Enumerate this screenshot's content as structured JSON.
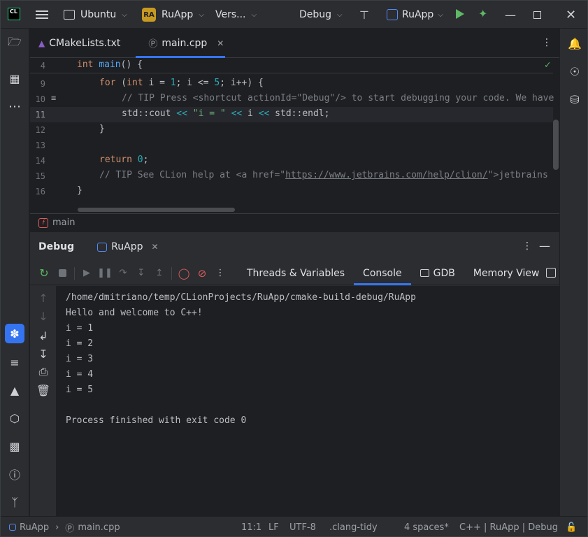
{
  "titlebar": {
    "logo": "CL",
    "workspace": "Ubuntu",
    "project_badge": "RA",
    "project": "RuApp",
    "vcs": "Vers...",
    "config": "Debug",
    "run_config": "RuApp"
  },
  "editor": {
    "tabs": [
      {
        "label": "CMakeLists.txt"
      },
      {
        "label": "main.cpp"
      }
    ],
    "lines": [
      {
        "num": "4"
      },
      {
        "num": "9"
      },
      {
        "num": "10"
      },
      {
        "num": "11"
      },
      {
        "num": "12"
      },
      {
        "num": "13"
      },
      {
        "num": "14"
      },
      {
        "num": "15"
      },
      {
        "num": "16"
      }
    ],
    "code": {
      "l4": {
        "kw": "int",
        "fn": "main",
        "rest": "() {"
      },
      "l9": {
        "kw": "for",
        "a": " (",
        "kw2": "int",
        "b": " i = ",
        "n1": "1",
        "c": "; i <= ",
        "n2": "5",
        "d": "; i++) {"
      },
      "l10": "// TIP Press <shortcut actionId=\"Debug\"/> to start debugging your code. We have",
      "l11": {
        "a": "std::cout ",
        "op1": "<<",
        "s": " \"i = \"",
        "sp": " ",
        "op2": "<<",
        "b": " i ",
        "op3": "<<",
        "c": " std::endl;"
      },
      "l12": "}",
      "l14": {
        "kw": "return",
        "n": "0",
        "semi": ";"
      },
      "l15": {
        "a": "// TIP See CLion help at <a href=\"",
        "link": "https://www.jetbrains.com/help/clion/",
        "b": "\">jetbrains"
      },
      "l16": "}"
    },
    "breadcrumb": "main"
  },
  "debug": {
    "title": "Debug",
    "session_tab": "RuApp",
    "subtabs": [
      {
        "label": "Threads & Variables"
      },
      {
        "label": "Console"
      },
      {
        "label": "GDB"
      },
      {
        "label": "Memory View"
      }
    ],
    "console_lines": [
      "/home/dmitriano/temp/CLionProjects/RuApp/cmake-build-debug/RuApp",
      "Hello and welcome to C++!",
      "i = 1",
      "i = 2",
      "i = 3",
      "i = 4",
      "i = 5",
      "",
      "Process finished with exit code 0"
    ]
  },
  "statusbar": {
    "project": "RuApp",
    "file": "main.cpp",
    "position": "11:1",
    "line_sep": "LF",
    "encoding": "UTF-8",
    "linter": ".clang-tidy",
    "indent": "4 spaces*",
    "context": "C++ | RuApp | Debug"
  },
  "colors": {
    "accent": "#3574f0",
    "run": "#5fb865",
    "badge": "#c79a22"
  }
}
